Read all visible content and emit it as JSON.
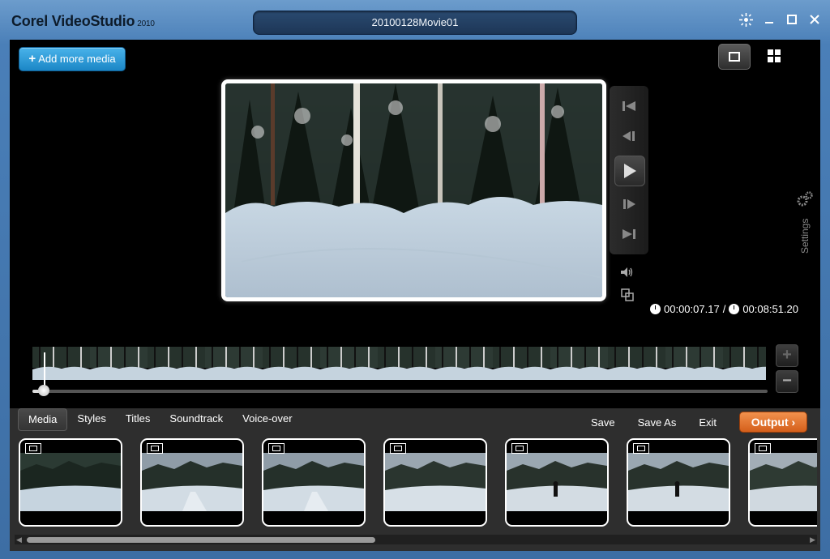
{
  "app": {
    "title": "Corel VideoStudio",
    "version": "2010"
  },
  "project": {
    "name": "20100128Movie01"
  },
  "toolbar": {
    "add_media_label": "Add more media"
  },
  "side": {
    "settings_label": "Settings"
  },
  "timecode": {
    "current": "00:00:07.17",
    "separator": "/",
    "total": "00:08:51.20"
  },
  "scrubber": {
    "position": 0.015
  },
  "tabs": [
    "Media",
    "Styles",
    "Titles",
    "Soundtrack",
    "Voice-over"
  ],
  "active_tab": "Media",
  "actions": {
    "save": "Save",
    "save_as": "Save As",
    "exit": "Exit",
    "output": "Output"
  },
  "colors": {
    "accent_blue": "#1b86c6",
    "output_orange": "#e8752f",
    "frame": "#3d6ea4",
    "bg": "#000000"
  },
  "media_clips": [
    {
      "type": "video",
      "scene": "forest-snow"
    },
    {
      "type": "video",
      "scene": "field-road"
    },
    {
      "type": "video",
      "scene": "field-road"
    },
    {
      "type": "video",
      "scene": "field-snow"
    },
    {
      "type": "video",
      "scene": "field-person"
    },
    {
      "type": "video",
      "scene": "field-person"
    },
    {
      "type": "video",
      "scene": "field-fence"
    }
  ]
}
